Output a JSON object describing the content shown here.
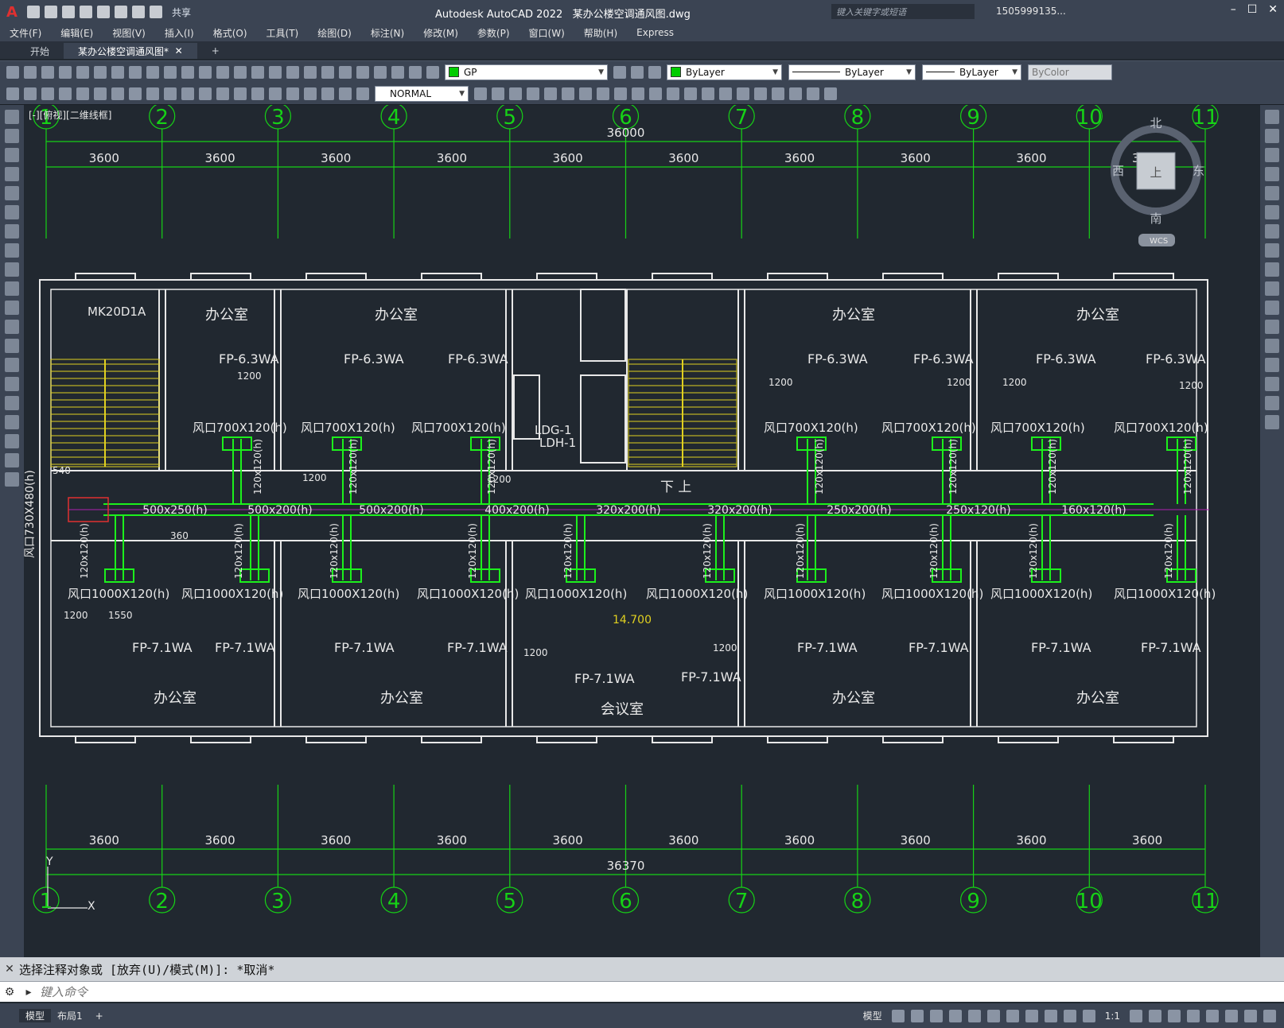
{
  "app": {
    "title": "Autodesk AutoCAD 2022",
    "file": "某办公楼空调通风图.dwg"
  },
  "titlebar": {
    "share": "共享",
    "search_placeholder": "键入关键字或短语",
    "user": "1505999135..."
  },
  "menu": [
    "文件(F)",
    "编辑(E)",
    "视图(V)",
    "插入(I)",
    "格式(O)",
    "工具(T)",
    "绘图(D)",
    "标注(N)",
    "修改(M)",
    "参数(P)",
    "窗口(W)",
    "帮助(H)",
    "Express"
  ],
  "tabs": [
    {
      "label": "开始"
    },
    {
      "label": "某办公楼空调通风图*"
    }
  ],
  "toolbar1": {
    "layer": "GP",
    "color": "ByLayer",
    "linetype": "ByLayer",
    "lineweight": "ByLayer",
    "plotstyle": "ByColor",
    "layer_color": "#00cc00",
    "color_swatch": "#00cc00"
  },
  "toolbar2": {
    "style": "NORMAL"
  },
  "viewport": {
    "label": "[-][俯视][二维线框]"
  },
  "compass": {
    "north": "北",
    "south": "南",
    "east": "东",
    "west": "西",
    "top": "上",
    "wcs": "WCS"
  },
  "drawing": {
    "axes": [
      "1",
      "2",
      "3",
      "4",
      "5",
      "6",
      "7",
      "8",
      "9",
      "10",
      "11"
    ],
    "top_total": "36000",
    "top_dims": [
      "3600",
      "3600",
      "3600",
      "3600",
      "3600",
      "3600",
      "3600",
      "3600",
      "3600",
      "3600"
    ],
    "bottom_total": "36370",
    "bottom_dims": [
      "3600",
      "3600",
      "3600",
      "3600",
      "3600",
      "3600",
      "3600",
      "3600",
      "3600",
      "3600"
    ],
    "rooms_top": [
      "办公室",
      "办公室",
      "办公室",
      "办公室"
    ],
    "rooms_bottom": [
      "办公室",
      "办公室",
      "会议室",
      "办公室",
      "办公室"
    ],
    "units_top": [
      "FP-6.3WA",
      "FP-6.3WA",
      "FP-6.3WA",
      "FP-6.3WA",
      "FP-6.3WA",
      "FP-6.3WA",
      "FP-6.3WA"
    ],
    "units_bottom": [
      "FP-7.1WA",
      "FP-7.1WA",
      "FP-7.1WA",
      "FP-7.1WA",
      "FP-7.1WA",
      "FP-7.1WA",
      "FP-7.1WA",
      "FP-7.1WA",
      "FP-7.1WA",
      "FP-7.1WA"
    ],
    "vents_top": [
      "风口700X120(h)",
      "风口700X120(h)",
      "风口700X120(h)",
      "风口700X120(h)",
      "风口700X120(h)",
      "风口700X120(h)",
      "风口700X120(h)"
    ],
    "vents_bottom": [
      "风口1000X120(h)",
      "风口1000X120(h)",
      "风口1000X120(h)",
      "风口1000X120(h)",
      "风口1000X120(h)",
      "风口1000X120(h)",
      "风口1000X120(h)",
      "风口1000X120(h)",
      "风口1000X120(h)",
      "风口1000X120(h)"
    ],
    "ducts": [
      "500x250(h)",
      "500x200(h)",
      "500x200(h)",
      "400x200(h)",
      "320x200(h)",
      "320x200(h)",
      "250x200(h)",
      "250x120(h)",
      "160x120(h)"
    ],
    "branch": "120x120(h)",
    "misc": {
      "mk": "MK20D1A",
      "dim540": "540",
      "dim360": "360",
      "dim1200": "1200",
      "dim1550": "1550",
      "inlet": "风口730X480(h)",
      "ldg": "LDG-1",
      "ldh": "LDH-1",
      "stair": "下 上",
      "elev": "14.700"
    },
    "ucs": {
      "x": "X",
      "y": "Y"
    }
  },
  "command": {
    "history": "选择注释对象或 [放弃(U)/模式(M)]: *取消*",
    "placeholder": "键入命令"
  },
  "status": {
    "model": "模型",
    "layout": "布局1",
    "model_btn": "模型",
    "scale": "1:1"
  }
}
